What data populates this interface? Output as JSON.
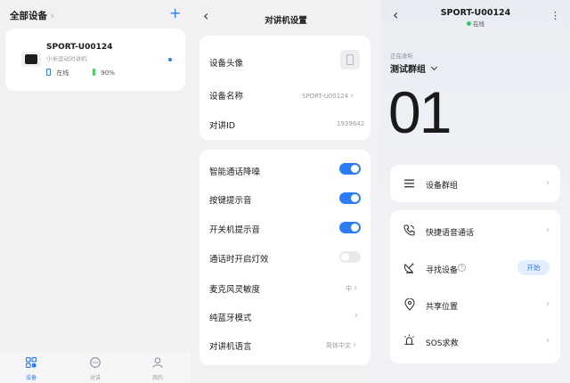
{
  "devices_screen": {
    "title": "全部设备",
    "add_symbol": "+",
    "device": {
      "name": "SPORT-U00124",
      "subtitle": "小米运动对讲机",
      "status": "在线",
      "battery": "90%"
    },
    "tabs": [
      {
        "label": "设备",
        "icon": "grid-icon",
        "active": true
      },
      {
        "label": "对讲",
        "icon": "chat-icon",
        "active": false
      },
      {
        "label": "我的",
        "icon": "person-icon",
        "active": false
      }
    ]
  },
  "settings_screen": {
    "back_symbol": "‹",
    "title": "对讲机设置",
    "avatar_label": "设备头像",
    "name_label": "设备名称",
    "name_value": "SPORT-U00124",
    "id_label": "对讲ID",
    "id_value": "1939642",
    "toggles": [
      {
        "label": "智能通话降噪",
        "on": true
      },
      {
        "label": "按键提示音",
        "on": true
      },
      {
        "label": "开关机提示音",
        "on": true
      },
      {
        "label": "通话时开启灯效",
        "on": false
      }
    ],
    "mic_label": "麦克风灵敏度",
    "mic_value": "中",
    "bt_label": "纯蓝牙模式",
    "lang_label": "对讲机语言",
    "lang_value": "简体中文"
  },
  "intercom_screen": {
    "back_symbol": "‹",
    "title": "SPORT-U00124",
    "status": "在线",
    "more_symbol": "⋮",
    "receiving_label": "正在收听",
    "group_name": "测试群组",
    "channel": "01",
    "group_item": "设备群组",
    "items": [
      {
        "label": "快捷语音通话",
        "icon": "phone-icon"
      },
      {
        "label": "寻找设备",
        "icon": "radar-icon"
      },
      {
        "label": "共享位置",
        "icon": "location-icon"
      },
      {
        "label": "SOS求救",
        "icon": "alarm-icon"
      }
    ],
    "help_symbol": "?",
    "find_button": "开始"
  },
  "colors": {
    "accent": "#2b7cf6",
    "online_green": "#3cc66b",
    "battery_green": "#4cd15a"
  }
}
